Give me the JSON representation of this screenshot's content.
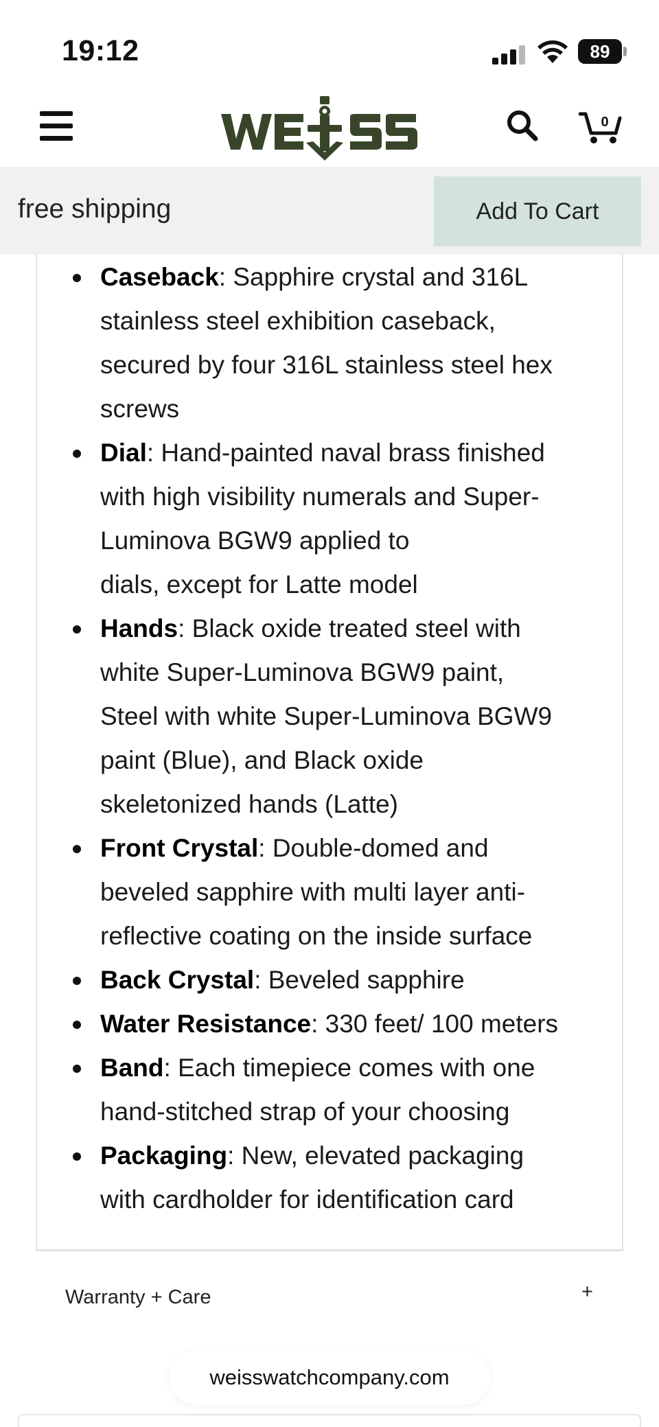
{
  "status_bar": {
    "time": "19:12",
    "battery": "89",
    "icons": [
      "signal-icon",
      "wifi-icon",
      "battery-icon"
    ]
  },
  "header": {
    "menu_icon": "hamburger-menu-icon",
    "logo_text": "WEISS",
    "search_icon": "search-icon",
    "cart_icon": "cart-icon",
    "cart_count": "0",
    "logo_color": "#38452a"
  },
  "sticky_bar": {
    "free_shipping": "free shipping",
    "add_to_cart": "Add To Cart",
    "button_color": "#d3e3db"
  },
  "specs": [
    {
      "term": "Caseback",
      "lines": [
        ": Sapphire crystal and 316L",
        "stainless steel exhibition caseback,",
        "secured by four 316L stainless steel hex",
        "screws"
      ]
    },
    {
      "term": "Dial",
      "lines": [
        ": Hand-painted naval brass finished",
        "with high visibility numerals and Super-",
        "Luminova BGW9 applied to",
        "dials, except for Latte model"
      ]
    },
    {
      "term": "Hands",
      "lines": [
        ": Black oxide treated steel with",
        "white Super-Luminova BGW9 paint,",
        "Steel with white Super-Luminova BGW9",
        "paint (Blue), and Black oxide",
        "skeletonized hands (Latte)"
      ]
    },
    {
      "term": "Front Crystal",
      "lines": [
        ": Double-domed and",
        "beveled sapphire with multi layer anti-",
        "reflective coating on the inside surface"
      ]
    },
    {
      "term": "Back Crystal",
      "lines": [
        ": Beveled sapphire"
      ]
    },
    {
      "term": "Water Resistance",
      "lines": [
        ": 330 feet/ 100 meters"
      ]
    },
    {
      "term": "Band",
      "lines": [
        ": Each timepiece comes with one",
        "hand-stitched strap of your choosing"
      ]
    },
    {
      "term": "Packaging",
      "lines": [
        ": New, elevated packaging",
        "with cardholder for identification card"
      ]
    }
  ],
  "accordion": {
    "title": "Warranty + Care",
    "toggle": "+"
  },
  "browser": {
    "url": "weisswatchcompany.com"
  }
}
